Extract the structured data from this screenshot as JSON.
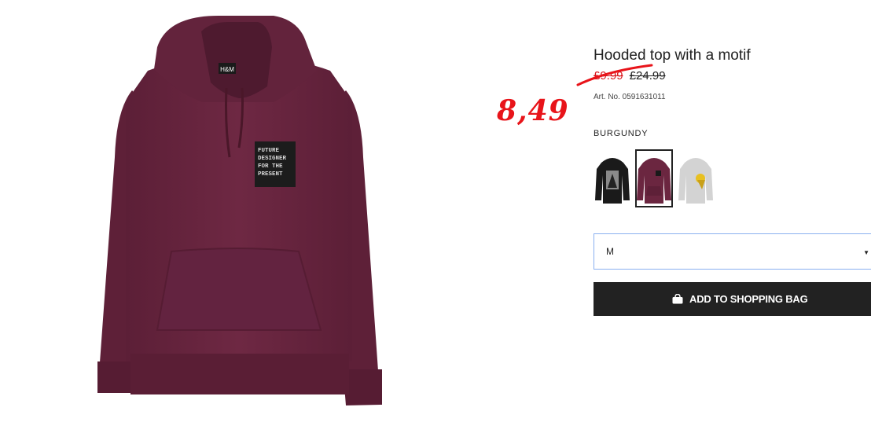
{
  "product": {
    "title": "Hooded top with a motif",
    "sale_price": "£9.99",
    "original_price": "£24.99",
    "art_no": "Art. No. 0591631011",
    "color_name": "BURGUNDY",
    "hoodie_logo": "H&M",
    "patch_text": [
      "FUTURE",
      "DESIGNER",
      "FOR THE",
      "PRESENT"
    ]
  },
  "annotation": {
    "handwritten_price": "8,49",
    "color": "#e8141a"
  },
  "swatches": [
    {
      "name": "black",
      "color": "#1a1a1a",
      "selected": false
    },
    {
      "name": "burgundy",
      "color": "#6b2640",
      "selected": true
    },
    {
      "name": "light-grey",
      "color": "#d3d3d3",
      "selected": false
    }
  ],
  "size_select": {
    "value": "M"
  },
  "add_button": {
    "label": "ADD TO SHOPPING BAG",
    "icon": "bag-icon"
  },
  "colors": {
    "hoodie": "#6b2640",
    "button": "#222222",
    "sale": "#d8141a",
    "select_border": "#8ab0f0"
  }
}
